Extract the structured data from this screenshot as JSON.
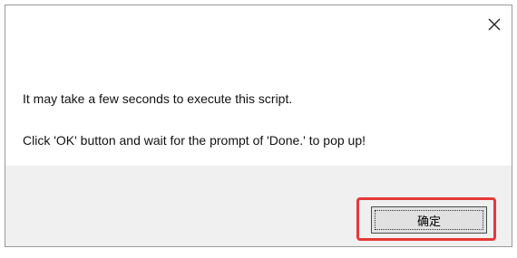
{
  "dialog": {
    "message_line_1": "It may take a few seconds to execute this script.",
    "message_line_2": "Click 'OK' button and wait for the prompt of 'Done.' to pop up!",
    "ok_button_label": "确定",
    "close_icon": "close-icon",
    "highlight_color": "#e53935"
  }
}
